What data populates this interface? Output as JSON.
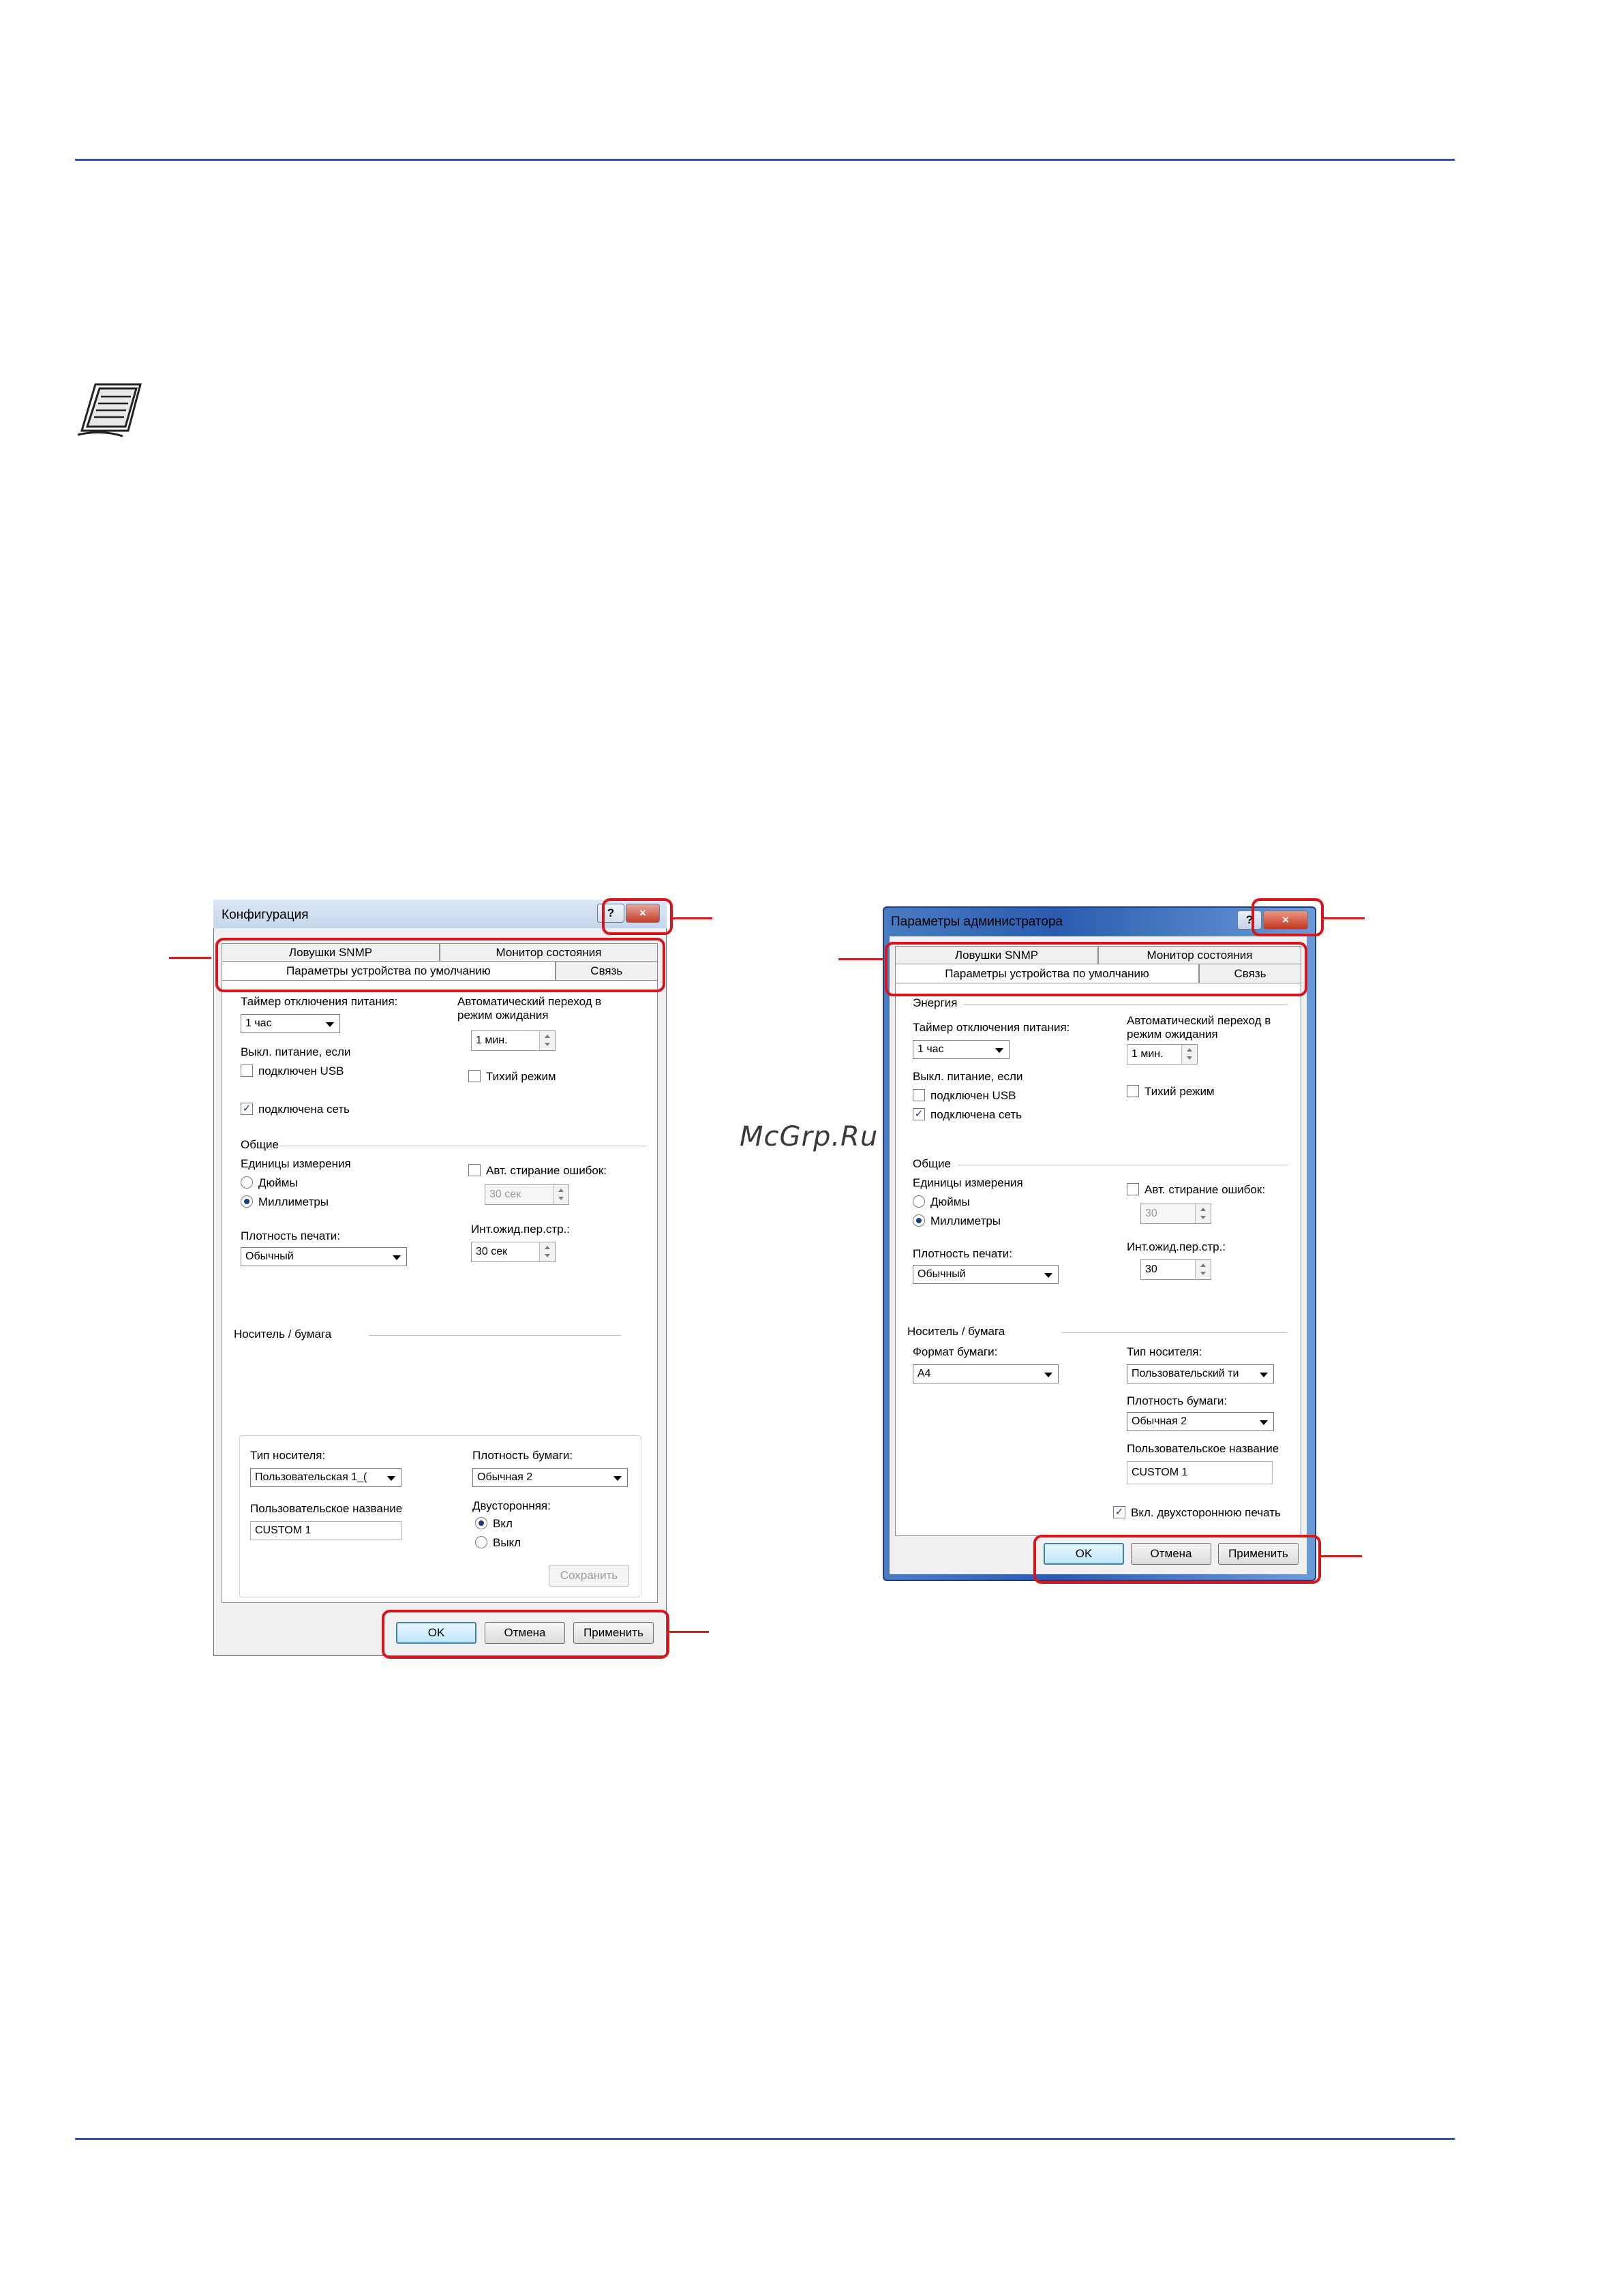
{
  "watermark": "McGrp.Ru",
  "dialog1": {
    "title": "Конфигурация",
    "help_label": "?",
    "close_label": "×",
    "tabs_top": [
      "Ловушки SNMP",
      "Монитор состояния"
    ],
    "tabs_bottom": [
      "Параметры устройства по умолчанию",
      "Связь"
    ],
    "power_timer_label": "Таймер отключения питания:",
    "power_timer_value": "1 час",
    "power_off_if_label": "Выкл. питание, если",
    "usb_label": "подключен USB",
    "network_label": "подключена сеть",
    "sleep_label_1": "Автоматический переход в",
    "sleep_label_2": "режим ожидания",
    "sleep_value": "1 мин.",
    "quiet_label": "Тихий режим",
    "general_group": "Общие",
    "units_label": "Единицы измерения",
    "inches_label": "Дюймы",
    "mm_label": "Миллиметры",
    "auto_error_label": "Авт. стирание ошибок:",
    "auto_error_value": "30 сек",
    "density_label": "Плотность печати:",
    "density_value": "Обычный",
    "timeout_label": "Инт.ожид.пер.стр.:",
    "timeout_value": "30 сек",
    "media_group": "Носитель / бумага",
    "media_type_label": "Тип носителя:",
    "media_type_value": "Пользовательская 1_(",
    "paper_weight_label": "Плотность бумаги:",
    "paper_weight_value": "Обычная 2",
    "custom_name_label": "Пользовательское название",
    "custom_name_value": "CUSTOM 1",
    "duplex_label": "Двусторонняя:",
    "duplex_on": "Вкл",
    "duplex_off": "Выкл",
    "save_label": "Сохранить",
    "ok_label": "OK",
    "cancel_label": "Отмена",
    "apply_label": "Применить"
  },
  "dialog2": {
    "title": "Параметры администратора",
    "help_label": "?",
    "close_label": "×",
    "tabs_top": [
      "Ловушки SNMP",
      "Монитор состояния"
    ],
    "tabs_bottom": [
      "Параметры устройства по умолчанию",
      "Связь"
    ],
    "energy_group": "Энергия",
    "power_timer_label": "Таймер отключения питания:",
    "power_timer_value": "1 час",
    "power_off_if_label": "Выкл. питание, если",
    "usb_label": "подключен USB",
    "network_label": "подключена сеть",
    "sleep_label_1": "Автоматический переход в",
    "sleep_label_2": "режим ожидания",
    "sleep_value": "1 мин.",
    "quiet_label": "Тихий режим",
    "general_group": "Общие",
    "units_label": "Единицы измерения",
    "inches_label": "Дюймы",
    "mm_label": "Миллиметры",
    "auto_error_label": "Авт. стирание ошибок:",
    "auto_error_value": "30",
    "density_label": "Плотность печати:",
    "density_value": "Обычный",
    "timeout_label": "Инт.ожид.пер.стр.:",
    "timeout_value": "30",
    "media_group": "Носитель / бумага",
    "paper_size_label": "Формат бумаги:",
    "paper_size_value": "A4",
    "media_type_label": "Тип носителя:",
    "media_type_value": "Пользовательский ти",
    "paper_weight_label": "Плотность бумаги:",
    "paper_weight_value": "Обычная 2",
    "custom_name_label": "Пользовательское название",
    "custom_name_value": "CUSTOM 1",
    "duplex_check_label": "Вкл. двухстороннюю печать",
    "ok_label": "OK",
    "cancel_label": "Отмена",
    "apply_label": "Применить"
  }
}
